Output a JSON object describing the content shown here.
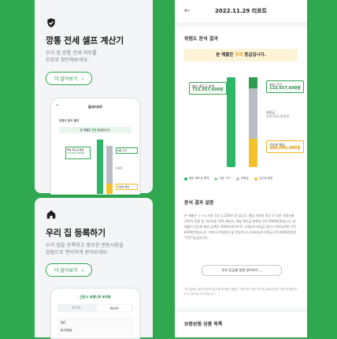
{
  "left": {
    "card1": {
      "title": "깡통 전세 셀프 계산기",
      "desc": "우리 집 깡통 전세 여부를\n무료로 확인해보세요.",
      "more": "더 알아보기",
      "mini": {
        "title": "결과리포트",
        "section": "위험도 분석 결과",
        "banner_pre": "본 매물은 ",
        "banner_hl": "안전",
        "banner_post": " 등급입니다.",
        "label1": "예상 매도금 총액",
        "value1": "715,557,600원",
        "label2": "여유 구간",
        "label3": "보증금",
        "label4": "선순위 채권"
      }
    },
    "card2": {
      "title": "우리 집 등록하기",
      "desc": "우리 집을 등록하고 중요한 변동사항을\n알람으로 편리하게 받아보세요.",
      "more": "더 알아보기",
      "mini": {
        "title": "인천시 부평나루 부역동",
        "tab1": "등기정보",
        "tab2": "알림설정",
        "row1": "집값",
        "row2": "등기부등본"
      }
    }
  },
  "phone": {
    "nav_title": "2022.11.29 리포트",
    "section1_title": "위험도 분석 결과",
    "banner_pre": "본 매물은 ",
    "banner_hl": "주의",
    "banner_post": " 등급입니다.",
    "labels": {
      "total_label": "예상 매도금 총액",
      "total_value": "715,557,600원",
      "spare_label": "여유 구간",
      "spare_value": "115,557,600원",
      "deposit_label": "보증금",
      "deposit_value": "300,000,000원",
      "senior_label": "선순위 채권",
      "senior_value": "300,000,000원"
    },
    "legend": [
      "예상 매도금 총액",
      "여유 구간",
      "보증금",
      "선순위 채권"
    ],
    "section2_title": "분석 결과 설명",
    "paragraph": "본 매물은 ㅇㅇ시 기준 공시 1,250만 원 입니다. 해당 지역의 최근 1~3년 낙찰가율 101% 적용 및 기타비용 10% 제외시, 예상 매도금 총액은 2억 2946만원입니다. 본 매물의 선순위 채권 금액은 3000만원이므로 고객님의 보증금 합산시 여유금액은 1억 8440만원입니다. 따라서 독립일자 및 전입신고시 Userly의 보증금 2억 6000만원은 \"안전\"등급입니다.",
    "button": "안부 등급별 설명 알아보기",
    "note": "*본 결과는 법적 효력이 없으며 위세한 내용은 \"약관\"와 관계 고객 및 유료가입자 개인 자문을 반드시 참조하시기 바랍니다.",
    "section3_title": "보증보험 상품 목록"
  },
  "colors": {
    "background": "#2fa84f",
    "bar_green": "#2cb667",
    "bar_grey": "#b9bdc3",
    "bar_yellow": "#f4c22d",
    "bar_darkgreen": "#2e9a4f",
    "legend_green": "#2cb667",
    "legend_lightgreen": "#8fd4a6",
    "legend_grey": "#bfc3c8",
    "legend_yellow": "#f4c22d"
  }
}
